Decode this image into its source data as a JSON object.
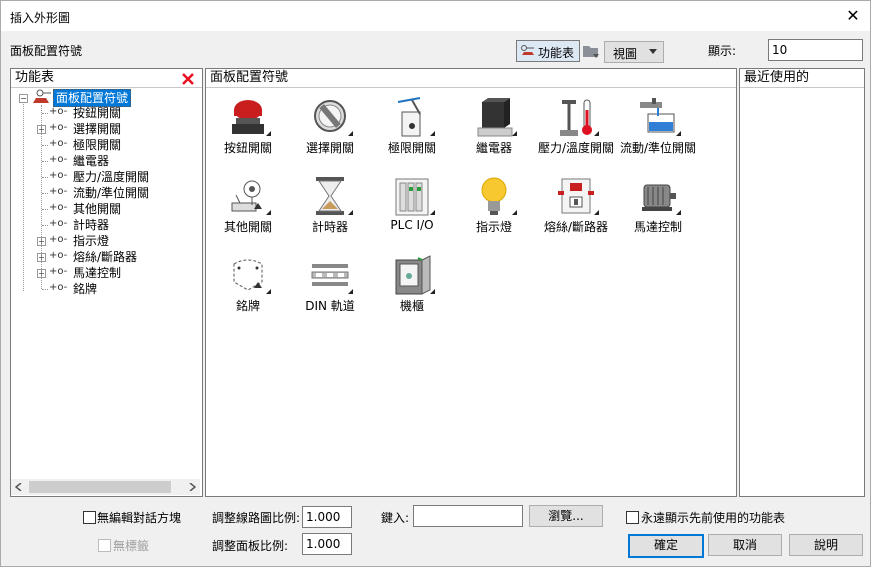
{
  "window": {
    "title": "插入外形圖",
    "close_glyph": "✕"
  },
  "toolbar": {
    "section_label": "面板配置符號",
    "menu_button": "功能表",
    "view_button": "視圖",
    "display_label": "顯示:",
    "display_value": "10"
  },
  "left_pane": {
    "header": "功能表",
    "root": "面板配置符號",
    "items": [
      {
        "label": "按鈕開關",
        "expandable": false
      },
      {
        "label": "選擇開關",
        "expandable": true
      },
      {
        "label": "極限開關",
        "expandable": false
      },
      {
        "label": "繼電器",
        "expandable": false
      },
      {
        "label": "壓力/溫度開關",
        "expandable": false
      },
      {
        "label": "流動/準位開關",
        "expandable": false
      },
      {
        "label": "其他開關",
        "expandable": false
      },
      {
        "label": "計時器",
        "expandable": false
      },
      {
        "label": "指示燈",
        "expandable": true
      },
      {
        "label": "熔絲/斷路器",
        "expandable": true
      },
      {
        "label": "馬達控制",
        "expandable": true
      },
      {
        "label": "銘牌",
        "expandable": false
      }
    ]
  },
  "center_pane": {
    "header": "面板配置符號",
    "icons": [
      {
        "label": "按鈕開關",
        "icon": "pushbutton-icon"
      },
      {
        "label": "選擇開關",
        "icon": "selector-switch-icon"
      },
      {
        "label": "極限開關",
        "icon": "limit-switch-icon"
      },
      {
        "label": "繼電器",
        "icon": "relay-icon"
      },
      {
        "label": "壓力/溫度開關",
        "icon": "pressure-temperature-icon"
      },
      {
        "label": "流動/準位開關",
        "icon": "flow-level-icon"
      },
      {
        "label": "其他開關",
        "icon": "other-switch-icon"
      },
      {
        "label": "計時器",
        "icon": "hourglass-icon"
      },
      {
        "label": "PLC I/O",
        "icon": "plc-io-icon"
      },
      {
        "label": "指示燈",
        "icon": "lightbulb-icon"
      },
      {
        "label": "熔絲/斷路器",
        "icon": "fuse-breaker-icon"
      },
      {
        "label": "馬達控制",
        "icon": "motor-icon"
      },
      {
        "label": "銘牌",
        "icon": "nameplate-icon"
      },
      {
        "label": "DIN 軌道",
        "icon": "din-rail-icon"
      },
      {
        "label": "機櫃",
        "icon": "cabinet-icon"
      }
    ]
  },
  "right_pane": {
    "header": "最近使用的"
  },
  "footer": {
    "no_edit_dialog": "無編輯對話方塊",
    "no_tag": "無標籤",
    "scale_label": "調整線路圖比例:",
    "scale_value": "1.000",
    "panel_scale_label": "調整面板比例:",
    "panel_scale_value": "1.000",
    "type_label": "鍵入:",
    "type_value": "",
    "browse_button": "瀏覽...",
    "always_show": "永遠顯示先前使用的功能表",
    "ok_button": "確定",
    "cancel_button": "取消",
    "help_button": "說明"
  },
  "colors": {
    "accent": "#0078d7",
    "selection": "#0078d7",
    "delete_x": "#e81123"
  }
}
